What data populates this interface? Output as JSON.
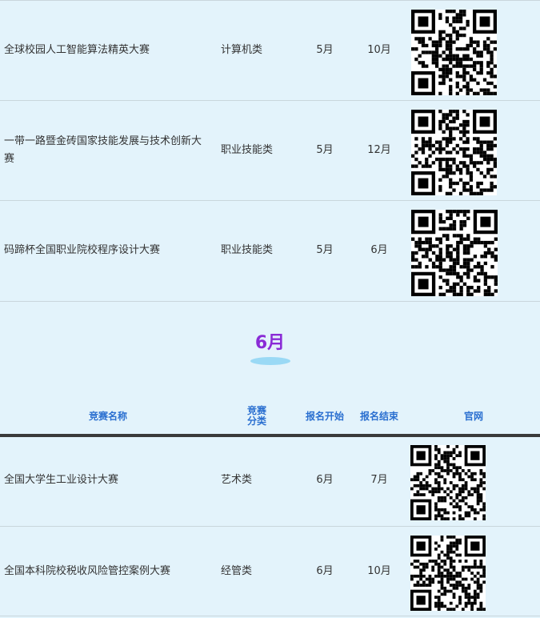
{
  "rows_top": [
    {
      "name": "全球校园人工智能算法精英大赛",
      "category": "计算机类",
      "start": "5月",
      "end": "10月",
      "qr": "qr-code"
    },
    {
      "name": "一带一路暨金砖国家技能发展与技术创新大赛",
      "category": "职业技能类",
      "start": "5月",
      "end": "12月",
      "qr": "qr-code"
    },
    {
      "name": "码蹄杯全国职业院校程序设计大赛",
      "category": "职业技能类",
      "start": "5月",
      "end": "6月",
      "qr": "qr-code"
    }
  ],
  "month": {
    "title": "6月"
  },
  "header": {
    "name": "竞赛名称",
    "category": "竞赛\n分类",
    "start": "报名开始",
    "end": "报名结束",
    "site": "官网"
  },
  "rows_bottom": [
    {
      "name": "全国大学生工业设计大赛",
      "category": "艺术类",
      "start": "6月",
      "end": "7月",
      "qr": "qr-code"
    },
    {
      "name": "全国本科院校税收风险管控案例大赛",
      "category": "经管类",
      "start": "6月",
      "end": "10月",
      "qr": "qr-code"
    }
  ],
  "colors": {
    "background": "#e3f3fb",
    "month_title": "#8a2bd6",
    "header_text": "#2a6fd0",
    "month_pill": "#9ad9f5"
  }
}
